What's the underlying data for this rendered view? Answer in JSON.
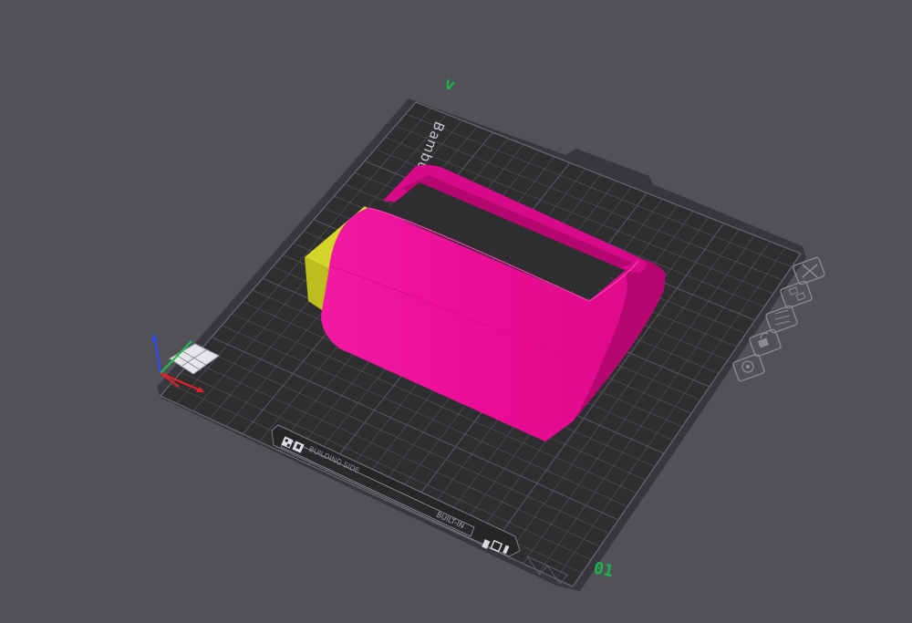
{
  "scene": {
    "background_color": "#515157",
    "plate_color": "#2e2e31",
    "grid_color": "#56565c",
    "plate_edge_color": "#68686e",
    "frame_color": "#38383c",
    "label_color": "#c8c8cc"
  },
  "plate": {
    "name_label": "Bambu Textured Plate",
    "number": "01",
    "number_color": "#19b44b",
    "corner_marker": "v",
    "strip_text": "BUILDING SIDE",
    "strip_small_text": "BUILT-IN",
    "strip_badge_icons": [
      "qr-code-icon",
      "bambu-logo-icon"
    ],
    "strip_end_icons": [
      "nozzle-icon",
      "square-icon",
      "bar-icon"
    ]
  },
  "objects": [
    {
      "name": "magenta-box-object",
      "color": "#ee0e98",
      "shade": "#d80a8a",
      "dark": "#b5076f"
    },
    {
      "name": "yellow-block-object",
      "color": "#d4d42a",
      "shade": "#bdbd1e"
    }
  ],
  "axes": {
    "x_color": "#e0202a",
    "y_color": "#1fbf4f",
    "z_color": "#2d4cff"
  },
  "plate_toolbar": [
    {
      "name": "close-plate-icon",
      "tooltip": "Remove plate"
    },
    {
      "name": "arrange-plate-icon",
      "tooltip": "Arrange"
    },
    {
      "name": "orient-plate-icon",
      "tooltip": "Auto orient"
    },
    {
      "name": "lock-plate-icon",
      "tooltip": "Lock plate"
    },
    {
      "name": "plate-settings-icon",
      "tooltip": "Plate settings"
    }
  ]
}
